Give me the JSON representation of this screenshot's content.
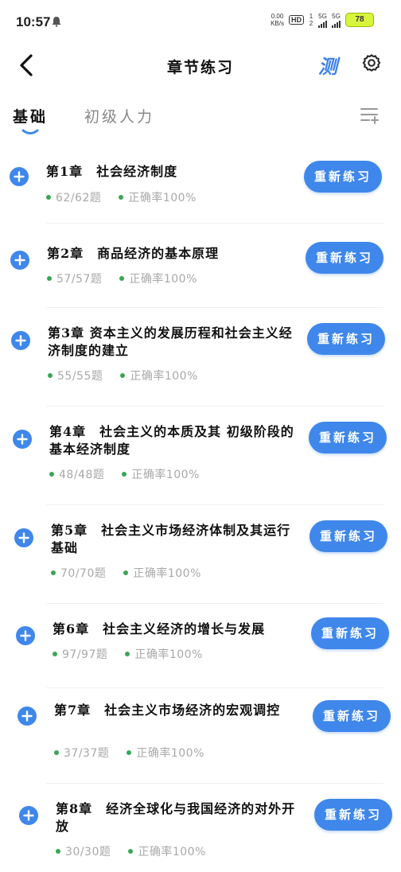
{
  "status": {
    "time": "10:57",
    "net_speed_value": "0.00",
    "net_speed_unit": "KB/s",
    "hd": "HD",
    "hd_sub": "1 2",
    "sig1": "5G",
    "sig2": "5G",
    "battery": "78"
  },
  "nav": {
    "title": "章节练习",
    "ce_label": "测"
  },
  "tabs": [
    {
      "label": "基础",
      "active": true
    },
    {
      "label": "初级人力",
      "active": false
    }
  ],
  "chapters": [
    {
      "title": "第1章　社会经济制度",
      "count": "62/62题",
      "accuracy": "正确率100%",
      "button": "重新练习"
    },
    {
      "title": "第2章　商品经济的基本原理",
      "count": "57/57题",
      "accuracy": "正确率100%",
      "button": "重新练习"
    },
    {
      "title": "第3章 资本主义的发展历程和社会主义经济制度的建立",
      "count": "55/55题",
      "accuracy": "正确率100%",
      "button": "重新练习"
    },
    {
      "title": "第4章　社会主义的本质及其 初级阶段的基本经济制度",
      "count": "48/48题",
      "accuracy": "正确率100%",
      "button": "重新练习"
    },
    {
      "title": "第5章　社会主义市场经济体制及其运行基础",
      "count": "70/70题",
      "accuracy": "正确率100%",
      "button": "重新练习"
    },
    {
      "title": "第6章　社会主义经济的增长与发展",
      "count": "97/97题",
      "accuracy": "正确率100%",
      "button": "重新练习"
    },
    {
      "title": "第7章　社会主义市场经济的宏观调控",
      "count": "37/37题",
      "accuracy": "正确率100%",
      "button": "重新练习"
    },
    {
      "title": "第8章　经济全球化与我国经济的对外开放",
      "count": "30/30题",
      "accuracy": "正确率100%",
      "button": "重新练习"
    }
  ],
  "colors": {
    "accent": "#3f87ea",
    "dot_green": "#3aa655",
    "meta_gray": "#a8a8a8",
    "battery": "#d8f53c"
  }
}
